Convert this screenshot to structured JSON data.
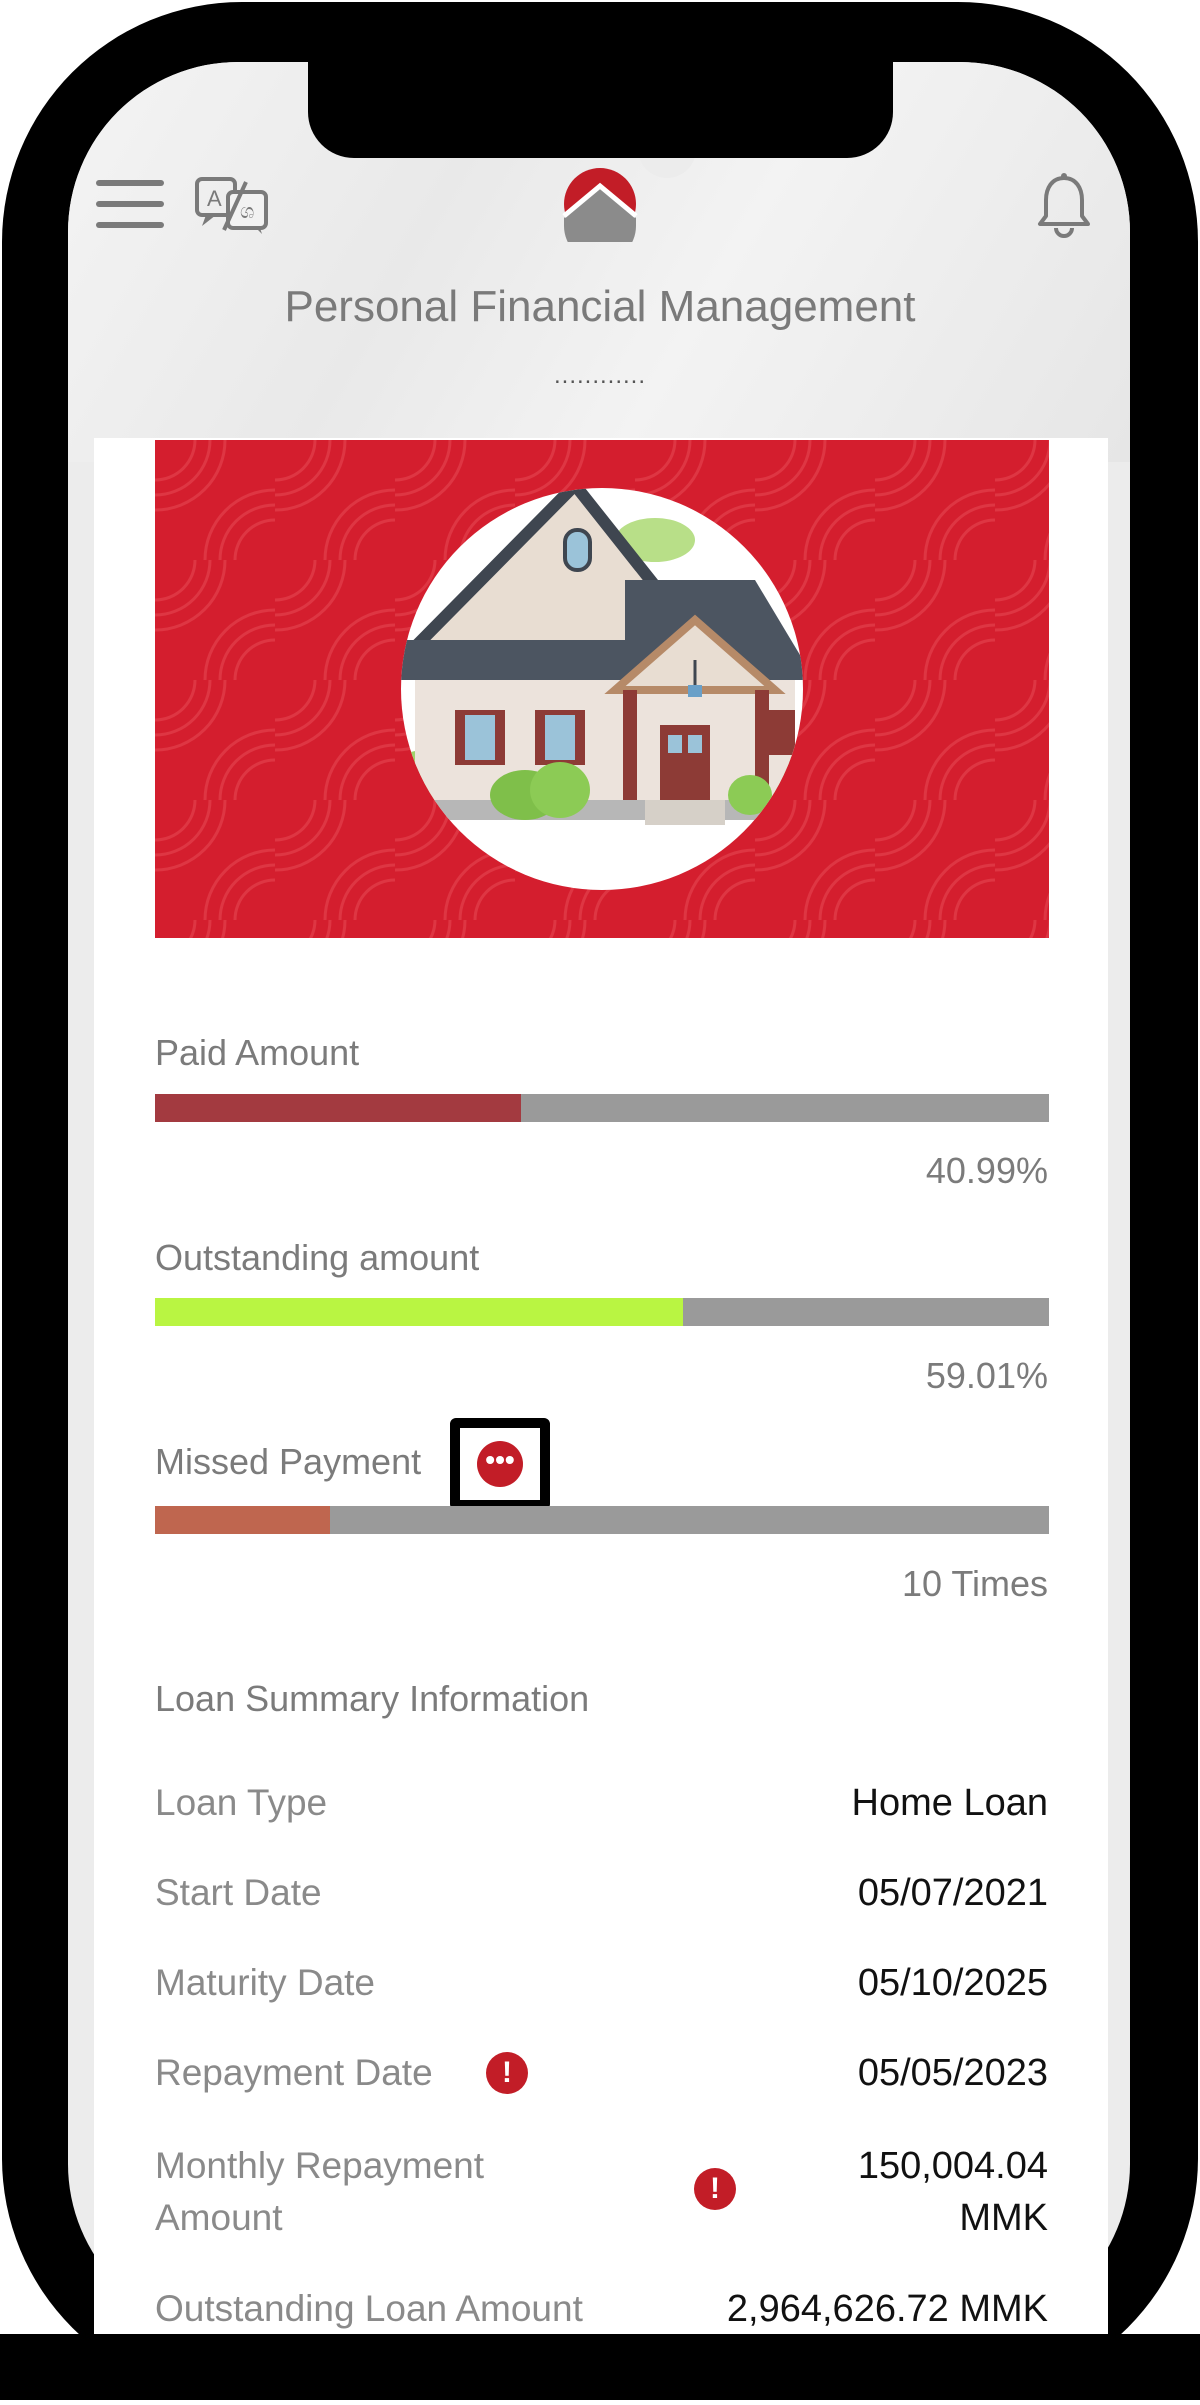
{
  "header": {
    "title": "Personal Financial Management",
    "subtitle_dots": "............",
    "menu_icon": "hamburger-menu-icon",
    "language_icon": "translate-icon",
    "logo_icon": "bank-logo-icon",
    "notification_icon": "bell-icon"
  },
  "banner": {
    "image": "house-illustration",
    "background_color": "#d41e2e"
  },
  "progress": {
    "paid": {
      "label": "Paid Amount",
      "value_text": "40.99%",
      "fraction": 0.4099,
      "color": "#a33a40"
    },
    "outstanding": {
      "label": "Outstanding amount",
      "value_text": "59.01%",
      "fraction": 0.5901,
      "color": "#b9f542"
    },
    "missed": {
      "label": "Missed Payment",
      "value_text": "10 Times",
      "fraction": 0.196,
      "color": "#bf664f",
      "more_icon": "more-dots-icon"
    }
  },
  "summary": {
    "title": "Loan Summary Information",
    "rows": [
      {
        "label": "Loan Type",
        "value": "Home Loan"
      },
      {
        "label": "Start Date",
        "value": "05/07/2021"
      },
      {
        "label": "Maturity Date",
        "value": "05/10/2025"
      },
      {
        "label": "Repayment Date",
        "value": "05/05/2023",
        "alert": true
      },
      {
        "label_line1": "Monthly Repayment",
        "label_line2": "Amount",
        "value_line1": "150,004.04",
        "value_line2": "MMK",
        "alert": true
      },
      {
        "label": "Outstanding Loan Amount",
        "value": "2,964,626.72 MMK"
      }
    ]
  },
  "colors": {
    "accent": "#c21d27",
    "bar_track": "#9a9a9a"
  }
}
